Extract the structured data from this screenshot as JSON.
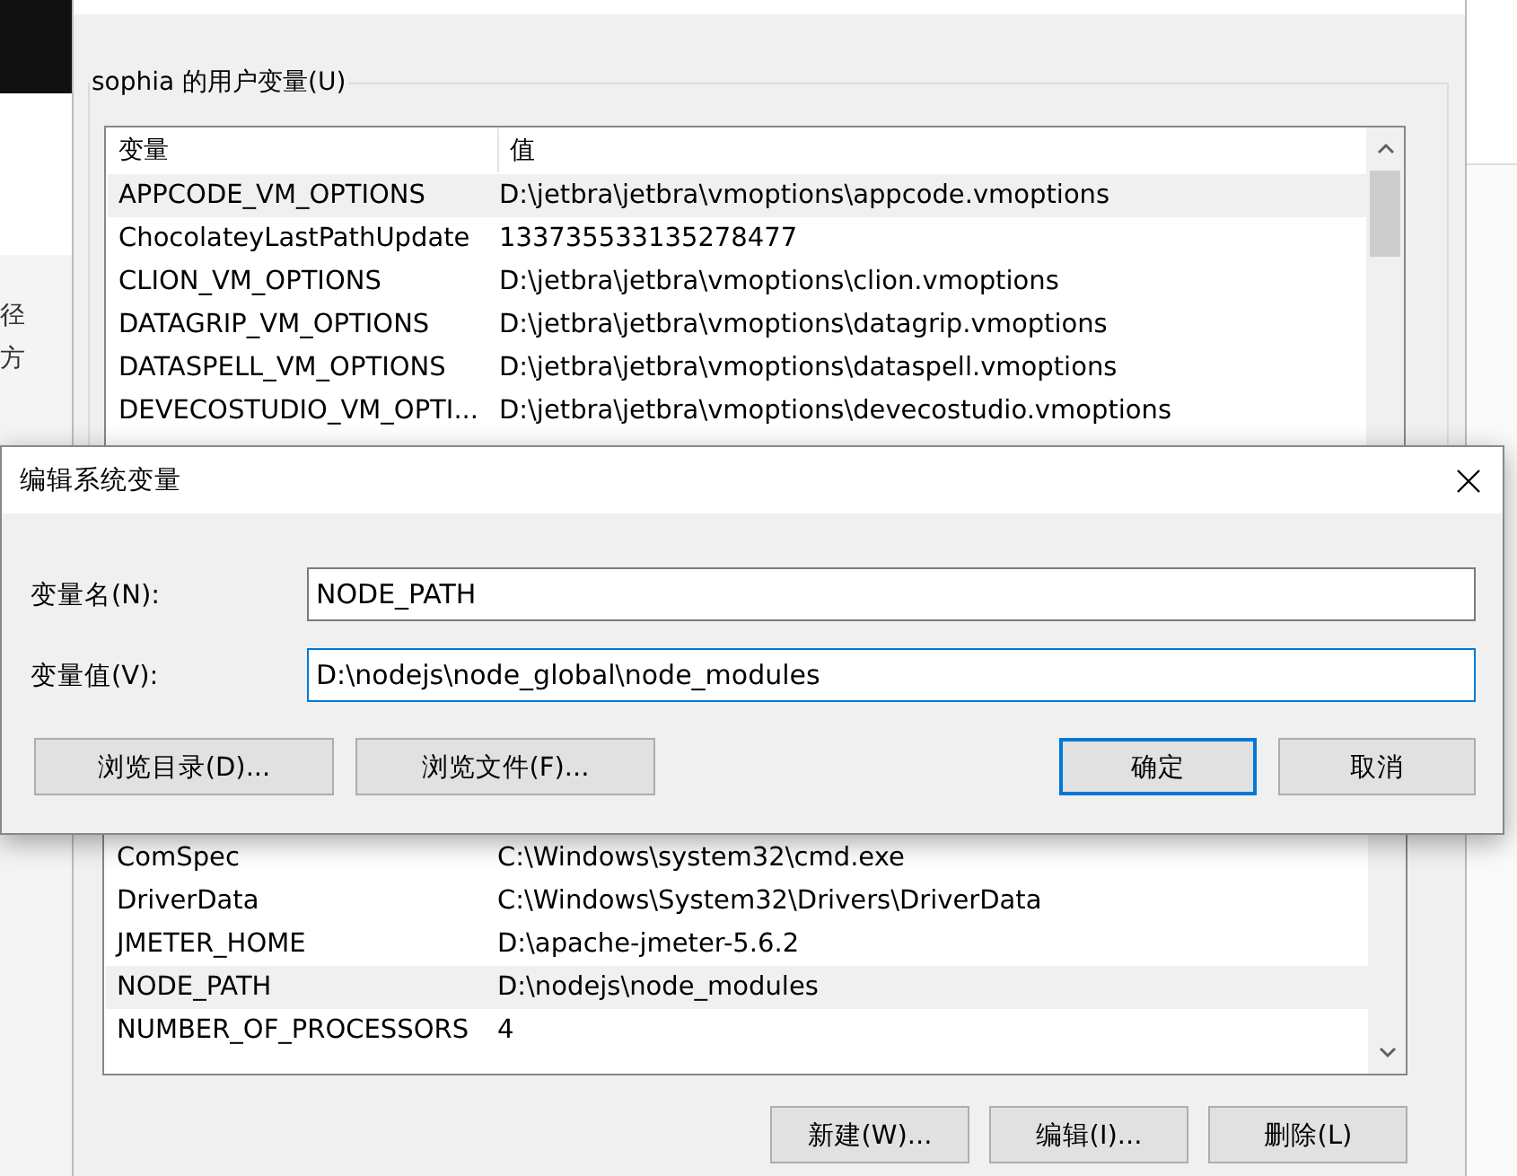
{
  "backdrop": {
    "side_texts": [
      "径",
      "方"
    ]
  },
  "window": {
    "user_group": {
      "title": "sophia 的用户变量(U)",
      "columns": [
        "变量",
        "值"
      ],
      "rows": [
        {
          "name": "APPCODE_VM_OPTIONS",
          "value": "D:\\jetbra\\jetbra\\vmoptions\\appcode.vmoptions",
          "selected": true
        },
        {
          "name": "ChocolateyLastPathUpdate",
          "value": "133735533135278477",
          "selected": false
        },
        {
          "name": "CLION_VM_OPTIONS",
          "value": "D:\\jetbra\\jetbra\\vmoptions\\clion.vmoptions",
          "selected": false
        },
        {
          "name": "DATAGRIP_VM_OPTIONS",
          "value": "D:\\jetbra\\jetbra\\vmoptions\\datagrip.vmoptions",
          "selected": false
        },
        {
          "name": "DATASPELL_VM_OPTIONS",
          "value": "D:\\jetbra\\jetbra\\vmoptions\\dataspell.vmoptions",
          "selected": false
        },
        {
          "name": "DEVECOSTUDIO_VM_OPTI...",
          "value": "D:\\jetbra\\jetbra\\vmoptions\\devecostudio.vmoptions",
          "selected": false
        }
      ]
    },
    "system_group": {
      "rows": [
        {
          "name": "ComSpec",
          "value": "C:\\Windows\\system32\\cmd.exe",
          "selected": false
        },
        {
          "name": "DriverData",
          "value": "C:\\Windows\\System32\\Drivers\\DriverData",
          "selected": false
        },
        {
          "name": "JMETER_HOME",
          "value": "D:\\apache-jmeter-5.6.2",
          "selected": false
        },
        {
          "name": "NODE_PATH",
          "value": "D:\\nodejs\\node_modules",
          "selected": true
        },
        {
          "name": "NUMBER_OF_PROCESSORS",
          "value": "4",
          "selected": false
        }
      ]
    },
    "buttons": [
      "新建(W)...",
      "编辑(I)...",
      "删除(L)"
    ]
  },
  "dialog": {
    "title": "编辑系统变量",
    "fields": [
      {
        "label": "变量名(N):",
        "value": "NODE_PATH",
        "focused": false
      },
      {
        "label": "变量值(V):",
        "value": "D:\\nodejs\\node_global\\node_modules",
        "focused": true
      }
    ],
    "buttons": [
      {
        "label": "浏览目录(D)...",
        "kind": "browse",
        "default": false
      },
      {
        "label": "浏览文件(F)...",
        "kind": "browse",
        "default": false
      },
      {
        "label": "确定",
        "kind": "confirm",
        "default": true
      },
      {
        "label": "取消",
        "kind": "confirm",
        "default": false
      }
    ]
  }
}
